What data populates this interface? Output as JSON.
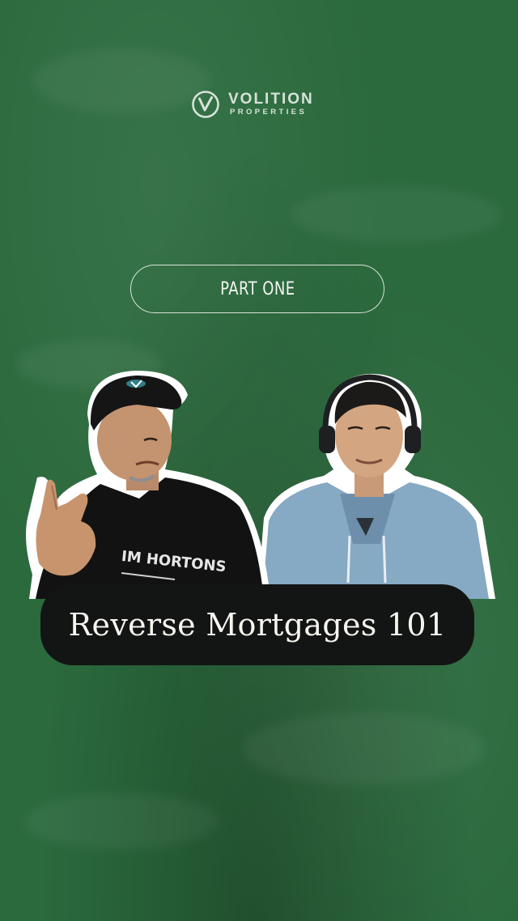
{
  "logo": {
    "name": "VOLITION",
    "subtitle": "PROPERTIES",
    "icon": "volition-v-logo-icon"
  },
  "part_label": "PART ONE",
  "title": "Reverse Mortgages 101",
  "shirt_text": "IM HORTONS",
  "colors": {
    "background": "#2b6a3d",
    "banner": "#131514",
    "text_light": "#f6f5ef",
    "logo": "#d7e2d9"
  }
}
